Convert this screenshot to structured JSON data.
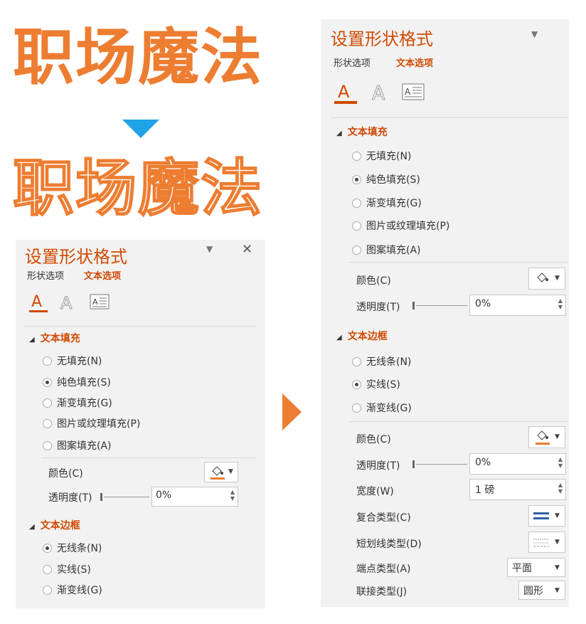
{
  "headline": {
    "text": "职场魔法",
    "color": "#ED7D31"
  },
  "arrow_color_down": "#1FA2E6",
  "arrow_color_right": "#ED7D31",
  "left_panel": {
    "title": "设置形状格式",
    "tabs": [
      "形状选项",
      "文本选项"
    ],
    "fill_section": "文本填充",
    "fill_options": [
      "无填充(N)",
      "纯色填充(S)",
      "渐变填充(G)",
      "图片或纹理填充(P)",
      "图案填充(A)"
    ],
    "fill_selected": 1,
    "color_label": "颜色(C)",
    "transparency_label": "透明度(T)",
    "transparency_value": "0%",
    "border_section": "文本边框",
    "border_options": [
      "无线条(N)",
      "实线(S)",
      "渐变线(G)"
    ],
    "border_selected": 0
  },
  "right_panel": {
    "title": "设置形状格式",
    "tabs": [
      "形状选项",
      "文本选项"
    ],
    "fill_section": "文本填充",
    "fill_options": [
      "无填充(N)",
      "纯色填充(S)",
      "渐变填充(G)",
      "图片或纹理填充(P)",
      "图案填充(A)"
    ],
    "fill_selected": 1,
    "color_label": "颜色(C)",
    "transparency_label": "透明度(T)",
    "transparency_value": "0%",
    "border_section": "文本边框",
    "border_options": [
      "无线条(N)",
      "实线(S)",
      "渐变线(G)"
    ],
    "border_selected": 1,
    "border_color_label": "颜色(C)",
    "border_transparency_label": "透明度(T)",
    "border_transparency_value": "0%",
    "width_label": "宽度(W)",
    "width_value": "1 磅",
    "compound_label": "复合类型(C)",
    "dash_label": "短划线类型(D)",
    "cap_label": "端点类型(A)",
    "cap_value": "平面",
    "join_label": "联接类型(J)",
    "join_value": "圆形"
  }
}
